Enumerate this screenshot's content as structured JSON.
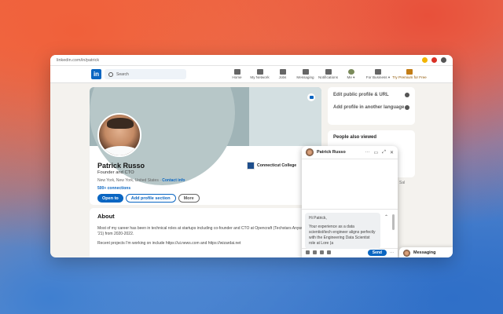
{
  "browser": {
    "url": "linkedin.com/in/patrick"
  },
  "nav": {
    "search_placeholder": "Search",
    "items": [
      "Home",
      "My Network",
      "Jobs",
      "Messaging",
      "Notifications",
      "Me ▾",
      "For Business ▾",
      "Try Premium for Free"
    ]
  },
  "profile": {
    "name": "Patrick Russo",
    "headline": "Founder and CTO",
    "location": "New York, New York, United States · ",
    "contact_info": "Contact info",
    "connections": "500+ connections",
    "company": "Connecticut College",
    "buttons": {
      "open_to": "Open to",
      "add_section": "Add profile section",
      "more": "More"
    }
  },
  "about": {
    "title": "About",
    "p1": "Most of my career has been in technical roles at startups including co-founder and CTO at Opencraft (Techstars Anywhere '21) from 2020-2022.",
    "p2": "Recent projects I'm working on include https://ui.news.com and https://wizardai.net"
  },
  "sidebar": {
    "edit_public": "Edit public profile & URL",
    "add_language": "Add profile in another language",
    "people_also_viewed": "People also viewed",
    "peek_text": "Sal"
  },
  "chat": {
    "name": "Patrick Russo",
    "draft_lines": [
      "Hi Patrick,",
      "Your experience as a data scientist/tech engineer aligns perfectly with the Engineering Data Scientist role at Lore (a"
    ],
    "send": "Send",
    "more": "···"
  },
  "messaging_bar": {
    "label": "Messaging"
  }
}
